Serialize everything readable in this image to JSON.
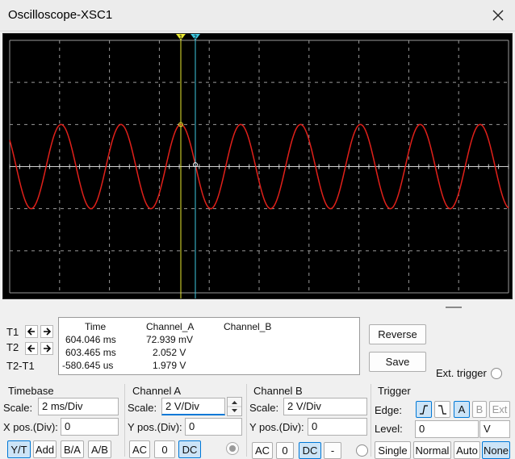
{
  "window": {
    "title": "Oscilloscope-XSC1"
  },
  "screen": {
    "cursor1_label": "1",
    "cursor2_label": "2",
    "colors": {
      "background": "#000000",
      "grid": "#9a9a9a",
      "trace_a": "#e0201a",
      "cursor1": "#e8e830",
      "cursor2": "#3ec8e0"
    }
  },
  "readout": {
    "headers": {
      "time": "Time",
      "channel_a": "Channel_A",
      "channel_b": "Channel_B"
    },
    "rows": [
      {
        "label": "T1",
        "time": "604.046 ms",
        "a": "72.939 mV",
        "b": ""
      },
      {
        "label": "T2",
        "time": "603.465 ms",
        "a": "2.052 V",
        "b": ""
      },
      {
        "label": "T2-T1",
        "time": "-580.645 us",
        "a": "1.979 V",
        "b": ""
      }
    ]
  },
  "buttons": {
    "reverse": "Reverse",
    "save": "Save"
  },
  "ext_trigger": {
    "label": "Ext. trigger"
  },
  "timebase": {
    "title": "Timebase",
    "scale_label": "Scale:",
    "scale_value": "2 ms/Div",
    "xpos_label": "X pos.(Div):",
    "xpos_value": "0",
    "modes": [
      "Y/T",
      "Add",
      "B/A",
      "A/B"
    ],
    "active_mode": "Y/T"
  },
  "channel_a": {
    "title": "Channel A",
    "scale_label": "Scale:",
    "scale_value": "2  V/Div",
    "ypos_label": "Y pos.(Div):",
    "ypos_value": "0",
    "coupling": [
      "AC",
      "0",
      "DC"
    ],
    "active_coupling": "DC"
  },
  "channel_b": {
    "title": "Channel B",
    "scale_label": "Scale:",
    "scale_value": "2  V/Div",
    "ypos_label": "Y pos.(Div):",
    "ypos_value": "0",
    "coupling": [
      "AC",
      "0",
      "DC",
      "-"
    ],
    "active_coupling": "DC"
  },
  "trigger": {
    "title": "Trigger",
    "edge_label": "Edge:",
    "sources": [
      "A",
      "B",
      "Ext"
    ],
    "active_source": "A",
    "level_label": "Level:",
    "level_value": "0",
    "level_unit": "V",
    "modes": [
      "Single",
      "Normal",
      "Auto",
      "None"
    ],
    "active_mode": "None"
  }
}
